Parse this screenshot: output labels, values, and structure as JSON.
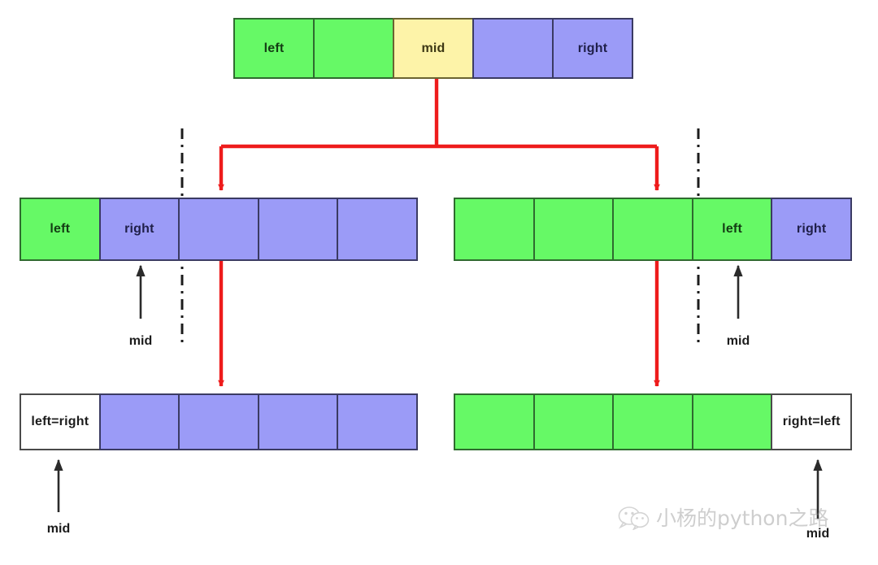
{
  "diagram": {
    "title": "binary-search-left-right-mid-partition",
    "colors": {
      "green": "#66f966",
      "blue": "#9b9bf7",
      "yellow": "#fdf3a8",
      "white": "#ffffff",
      "red_arrow": "#ee1c1c",
      "black_arrow": "#2b2b2b",
      "divider": "#1c1c1c"
    },
    "arrays": [
      {
        "id": "top-array",
        "cells": [
          {
            "label": "left",
            "fill": "green"
          },
          {
            "label": "",
            "fill": "green"
          },
          {
            "label": "mid",
            "fill": "yellow"
          },
          {
            "label": "",
            "fill": "blue"
          },
          {
            "label": "right",
            "fill": "blue"
          }
        ]
      },
      {
        "id": "middle-left-array",
        "cells": [
          {
            "label": "left",
            "fill": "green"
          },
          {
            "label": "right",
            "fill": "blue"
          },
          {
            "label": "",
            "fill": "blue"
          },
          {
            "label": "",
            "fill": "blue"
          },
          {
            "label": "",
            "fill": "blue"
          }
        ]
      },
      {
        "id": "middle-right-array",
        "cells": [
          {
            "label": "",
            "fill": "green"
          },
          {
            "label": "",
            "fill": "green"
          },
          {
            "label": "",
            "fill": "green"
          },
          {
            "label": "left",
            "fill": "green"
          },
          {
            "label": "right",
            "fill": "blue"
          }
        ]
      },
      {
        "id": "bottom-left-array",
        "cells": [
          {
            "label": "left=right",
            "fill": "white"
          },
          {
            "label": "",
            "fill": "blue"
          },
          {
            "label": "",
            "fill": "blue"
          },
          {
            "label": "",
            "fill": "blue"
          },
          {
            "label": "",
            "fill": "blue"
          }
        ]
      },
      {
        "id": "bottom-right-array",
        "cells": [
          {
            "label": "",
            "fill": "green"
          },
          {
            "label": "",
            "fill": "green"
          },
          {
            "label": "",
            "fill": "green"
          },
          {
            "label": "",
            "fill": "green"
          },
          {
            "label": "right=left",
            "fill": "white"
          }
        ]
      }
    ],
    "mid_labels": [
      {
        "id": "mid-label-middle-left",
        "text": "mid"
      },
      {
        "id": "mid-label-middle-right",
        "text": "mid"
      },
      {
        "id": "mid-label-bottom-left",
        "text": "mid"
      },
      {
        "id": "mid-label-bottom-right",
        "text": "mid"
      }
    ],
    "watermark": {
      "icon": "wechat-icon",
      "text": "小杨的python之路"
    }
  }
}
